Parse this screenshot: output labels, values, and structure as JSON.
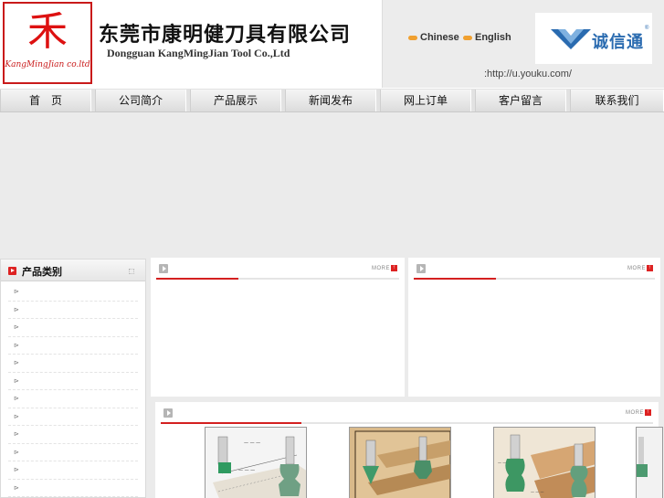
{
  "header": {
    "logo_glyph": "⽲",
    "logo_subtitle": "KangMingJian co.ltd",
    "company_name_cn": "东莞市康明健刀具有限公司",
    "company_name_en": "Dongguan KangMingJian Tool Co.,Ltd",
    "lang_chinese": "Chinese",
    "lang_english": "English",
    "partner_logo_text": "诚信通",
    "partner_logo_mark": "®",
    "video_url": ":http://u.youku.com/"
  },
  "nav": {
    "items": [
      {
        "label": "首　页"
      },
      {
        "label": "公司简介"
      },
      {
        "label": "产品展示"
      },
      {
        "label": "新闻发布"
      },
      {
        "label": "网上订单"
      },
      {
        "label": "客户留言"
      },
      {
        "label": "联系我们"
      }
    ]
  },
  "sidebar": {
    "title": "产品类别",
    "item_count": 12
  },
  "panels": {
    "more_label": "MORE",
    "more_icon": "↑"
  },
  "colors": {
    "brand_red": "#d42020",
    "partner_blue": "#2a6bb0",
    "background": "#ebebeb"
  }
}
